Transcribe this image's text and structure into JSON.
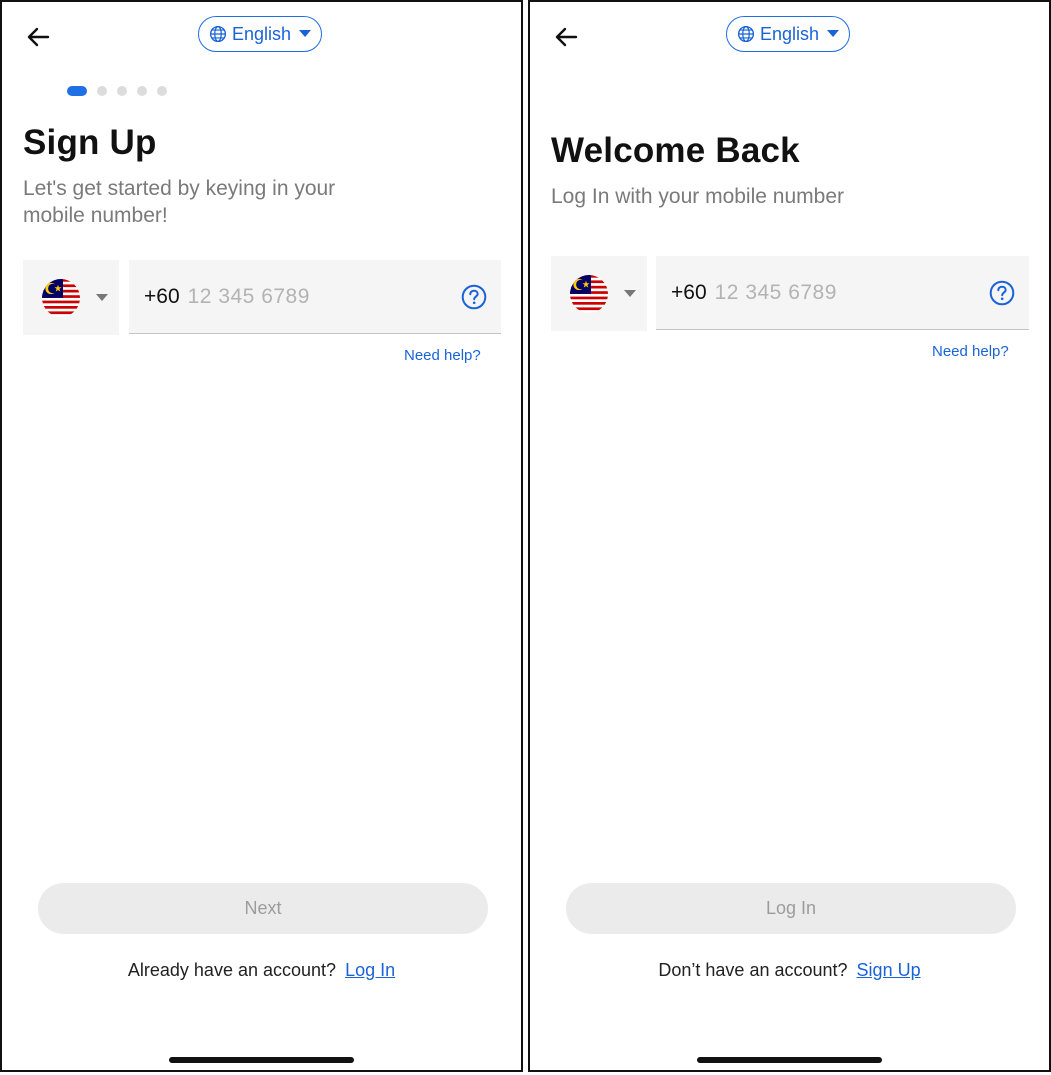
{
  "signup": {
    "language": "English",
    "step_count": 5,
    "active_step": 1,
    "title": "Sign Up",
    "subtitle_line1": "Let's get started by keying in your",
    "subtitle_line2": "mobile number!",
    "country_code": "+60",
    "phone_placeholder": "12 345 6789",
    "need_help": "Need help?",
    "next_button": "Next",
    "footer_text": "Already have an account?",
    "footer_link": "Log In"
  },
  "login": {
    "language": "English",
    "title": "Welcome Back",
    "subtitle": "Log In with your mobile number",
    "country_code": "+60",
    "phone_placeholder": "12 345 6789",
    "need_help": "Need help?",
    "login_button": "Log In",
    "footer_text": "Don’t have an account?",
    "footer_link": "Sign Up"
  },
  "icons": {
    "back": "arrow-left-icon",
    "language": "globe-icon",
    "dropdown": "caret-down-icon",
    "country_flag": "malaysia-flag-icon",
    "help": "question-circle-icon"
  },
  "colors": {
    "accent": "#1f6fe5",
    "disabled_button": "#ebebeb",
    "disabled_text": "#9c9c9c",
    "field_background": "#f5f5f5"
  }
}
